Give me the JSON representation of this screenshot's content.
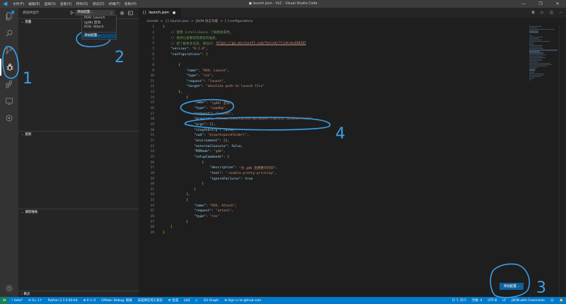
{
  "window": {
    "title": "● launch.json - VLC - Visual Studio Code",
    "menu": [
      "文件(F)",
      "编辑(E)",
      "选择(S)",
      "查看(V)",
      "转到(G)",
      "调试(D)",
      "终端(T)",
      "帮助(H)"
    ],
    "controls": [
      "—",
      "❐",
      "✕"
    ]
  },
  "sidebar": {
    "view_title": "调试并运行",
    "config_selected": "添加配置...",
    "sections": [
      "变量",
      "监视",
      "调用堆栈",
      "断点"
    ],
    "dropdown": [
      "ROS: Launch",
      "(gdb) 启动",
      "ROS: Attach",
      "添加配置..."
    ]
  },
  "editor": {
    "tab": "launch.json",
    "breadcrumb": [
      ".vscode",
      ">",
      "{} launch.json",
      ">",
      "JSON 语言功能",
      ">",
      "[ ] configurations"
    ],
    "lines": [
      [
        [
          "b",
          "{"
        ]
      ],
      [
        [
          "c",
          "    // 使用 IntelliSense 了解相关属性。"
        ]
      ],
      [
        [
          "c",
          "    // 悬停以查看现有属性的描述。"
        ]
      ],
      [
        [
          "c",
          "    // 欲了解更多信息，请访问: "
        ],
        [
          "url",
          "https://go.microsoft.com/fwlink/?linkid=830387"
        ]
      ],
      [
        [
          "k",
          "    \"version\""
        ],
        [
          "txt",
          ": "
        ],
        [
          "s",
          "\"0.2.0\""
        ],
        [
          "txt",
          ","
        ]
      ],
      [
        [
          "k",
          "    \"configurations\""
        ],
        [
          "txt",
          ": "
        ],
        [
          "b",
          "["
        ]
      ],
      [
        [
          "txt",
          ""
        ]
      ],
      [
        [
          "txt",
          "        {"
        ]
      ],
      [
        [
          "k",
          "            \"name\""
        ],
        [
          "txt",
          ": "
        ],
        [
          "s",
          "\"ROS: Launch\""
        ],
        [
          "txt",
          ","
        ]
      ],
      [
        [
          "k",
          "            \"type\""
        ],
        [
          "txt",
          ": "
        ],
        [
          "s",
          "\"ros\""
        ],
        [
          "txt",
          ","
        ]
      ],
      [
        [
          "k",
          "            \"request\""
        ],
        [
          "txt",
          ": "
        ],
        [
          "s",
          "\"launch\""
        ],
        [
          "txt",
          ","
        ]
      ],
      [
        [
          "k",
          "            \"target\""
        ],
        [
          "txt",
          ": "
        ],
        [
          "s",
          "\"absolute path to launch file\""
        ]
      ],
      [
        [
          "txt",
          "        },"
        ]
      ],
      [
        [
          "txt",
          "            {"
        ]
      ],
      [
        [
          "k",
          "                \"name\""
        ],
        [
          "txt",
          ": "
        ],
        [
          "s",
          "\"(gdb) 启动\""
        ],
        [
          "txt",
          ","
        ]
      ],
      [
        [
          "k",
          "                \"type\""
        ],
        [
          "txt",
          ": "
        ],
        [
          "s",
          "\"cppdbg\""
        ],
        [
          "txt",
          ","
        ]
      ],
      [
        [
          "k",
          "                \"request\""
        ],
        [
          "txt",
          ": "
        ],
        [
          "s",
          "\"launch\""
        ],
        [
          "txt",
          ","
        ]
      ],
      [
        [
          "k",
          "                \"program\""
        ],
        [
          "txt",
          ": "
        ],
        [
          "s",
          "\"/home/chen/catkin_ws/devel/lib/vlc_locator/test\""
        ],
        [
          "txt",
          ","
        ]
      ],
      [
        [
          "k",
          "                \"args\""
        ],
        [
          "txt",
          ": [],"
        ]
      ],
      [
        [
          "k",
          "                \"stopAtEntry\""
        ],
        [
          "txt",
          ": "
        ],
        [
          "k",
          "false"
        ],
        [
          "txt",
          ","
        ]
      ],
      [
        [
          "k",
          "                \"cwd\""
        ],
        [
          "txt",
          ": "
        ],
        [
          "s",
          "\"${workspaceFolder}\""
        ],
        [
          "txt",
          ","
        ]
      ],
      [
        [
          "k",
          "                \"environment\""
        ],
        [
          "txt",
          ": [],"
        ]
      ],
      [
        [
          "k",
          "                \"externalConsole\""
        ],
        [
          "txt",
          ": "
        ],
        [
          "k",
          "false"
        ],
        [
          "txt",
          ","
        ]
      ],
      [
        [
          "k",
          "                \"MIMode\""
        ],
        [
          "txt",
          ": "
        ],
        [
          "s",
          "\"gdb\""
        ],
        [
          "txt",
          ","
        ]
      ],
      [
        [
          "k",
          "                \"setupCommands\""
        ],
        [
          "txt",
          ": ["
        ]
      ],
      [
        [
          "txt",
          "                    {"
        ]
      ],
      [
        [
          "k",
          "                        \"description\""
        ],
        [
          "txt",
          ": "
        ],
        [
          "s",
          "\"为 gdb 启用整齐打印\""
        ],
        [
          "txt",
          ","
        ]
      ],
      [
        [
          "k",
          "                        \"text\""
        ],
        [
          "txt",
          ": "
        ],
        [
          "s",
          "\"-enable-pretty-printing\""
        ],
        [
          "txt",
          ","
        ]
      ],
      [
        [
          "k",
          "                        \"ignoreFailures\""
        ],
        [
          "txt",
          ": "
        ],
        [
          "k",
          "true"
        ]
      ],
      [
        [
          "txt",
          "                    }"
        ]
      ],
      [
        [
          "txt",
          "                ]"
        ]
      ],
      [
        [
          "txt",
          "            },"
        ]
      ],
      [
        [
          "txt",
          "            {"
        ]
      ],
      [
        [
          "k",
          "                \"name\""
        ],
        [
          "txt",
          ": "
        ],
        [
          "s",
          "\"ROS: Attach\""
        ],
        [
          "txt",
          ","
        ]
      ],
      [
        [
          "k",
          "                \"request\""
        ],
        [
          "txt",
          ": "
        ],
        [
          "s",
          "\"attach\""
        ],
        [
          "txt",
          ","
        ]
      ],
      [
        [
          "k",
          "                \"type\""
        ],
        [
          "txt",
          ": "
        ],
        [
          "s",
          "\"ros\""
        ]
      ],
      [
        [
          "txt",
          "            }"
        ]
      ],
      [
        [
          "b",
          "    ]"
        ]
      ],
      [
        [
          "b",
          "}"
        ]
      ]
    ],
    "add_config_button": "添加配置..."
  },
  "statusbar": {
    "remote": "⋊",
    "left": [
      "ᚠ beta*",
      "⟳ 0↓ 1↑",
      "Python 3.7.4 64-bit",
      "⊗ 0 ⚠ 0",
      "CMake: Debug: 就绪",
      "未选择任何工具包",
      "⚙ 生成",
      "[all]",
      "▷",
      "Git Graph",
      "⊕ Sign in to github.com"
    ],
    "right": [
      "行 7, 列 5",
      "空格: 4",
      "UTF-8",
      "LF",
      "JSON with Comments",
      "☺",
      "🔔"
    ]
  },
  "annotations": [
    "1",
    "2",
    "3",
    "4"
  ],
  "colors": {
    "accent": "#007acc",
    "button": "#0e639c",
    "annotation": "#3aa0e8"
  }
}
